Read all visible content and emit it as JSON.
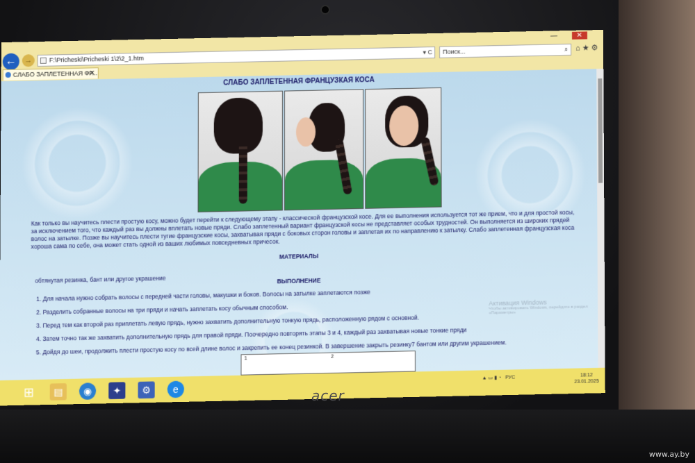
{
  "browser": {
    "address": "F:\\Pricheski\\Pricheski 1\\2\\2_1.htm",
    "search_placeholder": "Поиск...",
    "tab_title": "СЛАБО ЗАПЛЕТЕННАЯ ФР...",
    "tab_close": "✕",
    "back": "←",
    "forward": "→",
    "address_actions": "▾ C",
    "toolbar_icons": "⌂★⚙",
    "win_minimize": "—",
    "win_close": "✕"
  },
  "page": {
    "title": "СЛАБО ЗАПЛЕТЕННАЯ ФРАНЦУЗКАЯ КОСА",
    "intro": "Как только вы научитесь плести простую косу, можно будет перейти к следующему этапу - классической французской косе. Для ее выполнения используется тот же прием, что и для простой косы, за исключением того, что каждый раз вы должны вплетать новые пряди. Слабо заплетенный вариант французской косы не представляет особых трудностей. Он выполняется из широких прядей волос на затылке. Позже вы научитесь плести тугие французские косы, захватывая пряди с боковых сторон головы и заплетая их по направлению к затылку. Слабо заплетенная французская коса хороша сама по себе, она может стать одной из ваших любимых повседневных причесок.",
    "materials_heading": "МАТЕРИАЛЫ",
    "materials_text": "обтянутая резинка, бант или другое украшение",
    "steps_heading": "ВЫПОЛНЕНИЕ",
    "steps_intro": "Для начала нужно собрать волосы с передней части головы, макушки и боков. Волосы на затылке заплетаются позже",
    "steps": [
      "1. Для начала нужно собрать волосы с передней части головы, макушки и боков. Волосы на затылке заплетаются позже",
      "2. Разделить собранные волосы на три пряди и начать заплетать косу обычным способом.",
      "3. Перед тем как второй раз приплетать левую прядь, нужно захватить дополнительную тонкую прядь, расположенную рядом с основной.",
      "4. Затем точно так же захватить дополнительную прядь для правой пряди. Поочередно повторять этапы 3 и 4, каждый раз захватывая новые тонкие пряди",
      "5. Дойдя до шеи, продолжить плести простую косу по всей длине волос и закрепить ее конец резинкой. В завершение закрыть резинку7 бантом или другим украшением."
    ],
    "diagram_labels": [
      "1",
      "2"
    ],
    "activation_line1": "Активация Windows",
    "activation_line2": "Чтобы активировать Windows, перейдите в раздел «Параметры»"
  },
  "taskbar": {
    "start_icon": "⊞",
    "lang": "РУС",
    "time": "18:12",
    "date": "23.01.2025"
  },
  "device": {
    "brand": "acer",
    "watermark": "www.ay.by"
  }
}
